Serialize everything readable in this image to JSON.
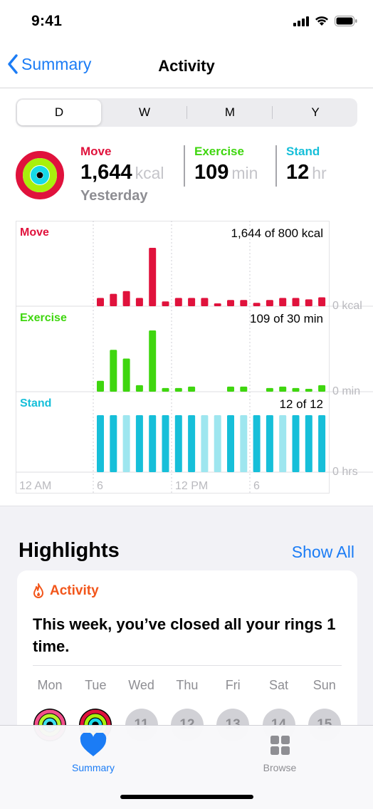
{
  "status_bar": {
    "time": "9:41"
  },
  "nav": {
    "back_label": "Summary",
    "title": "Activity"
  },
  "segments": [
    "D",
    "W",
    "M",
    "Y"
  ],
  "summary": {
    "move": {
      "label": "Move",
      "value": "1,644",
      "unit": "kcal"
    },
    "exercise": {
      "label": "Exercise",
      "value": "109",
      "unit": "min"
    },
    "stand": {
      "label": "Stand",
      "value": "12",
      "unit": "hr"
    },
    "day": "Yesterday"
  },
  "colors": {
    "move": "#e0123c",
    "exercise": "#3fd60f",
    "stand": "#16bfd9",
    "accent": "#1b7cf5",
    "highlight": "#f2561b"
  },
  "chart_data": {
    "type": "bar",
    "hours": [
      0,
      1,
      2,
      3,
      4,
      5,
      6,
      7,
      8,
      9,
      10,
      11,
      12,
      13,
      14,
      15,
      16,
      17,
      18,
      19,
      20,
      21,
      22,
      23
    ],
    "x_ticks": [
      "12 AM",
      "6",
      "12 PM",
      "6"
    ],
    "panels": [
      {
        "name": "Move",
        "total": "1,644 of 800 kcal",
        "axis_label": "0 kcal",
        "max": 85,
        "values": [
          0,
          0,
          0,
          0,
          0,
          0,
          12,
          18,
          22,
          12,
          85,
          7,
          12,
          12,
          12,
          4,
          9,
          9,
          5,
          9,
          12,
          12,
          10,
          13
        ]
      },
      {
        "name": "Exercise",
        "total": "109 of 30 min",
        "axis_label": "0 min",
        "max": 85,
        "values": [
          0,
          0,
          0,
          0,
          0,
          0,
          15,
          58,
          46,
          9,
          85,
          5,
          5,
          7,
          0,
          0,
          7,
          7,
          0,
          5,
          7,
          5,
          4,
          9
        ]
      },
      {
        "name": "Stand",
        "total": "12 of 12",
        "axis_label": "0 hrs",
        "max": 1,
        "values": [
          0,
          0,
          0,
          0,
          0,
          0,
          1,
          1,
          1,
          1,
          1,
          1,
          1,
          1,
          1,
          1,
          1,
          1,
          1,
          1,
          1,
          1,
          1,
          1
        ],
        "stood": [
          0,
          0,
          0,
          0,
          0,
          0,
          1,
          1,
          0,
          1,
          1,
          1,
          1,
          1,
          0,
          0,
          1,
          0,
          1,
          1,
          0,
          1,
          1,
          1
        ]
      }
    ]
  },
  "highlights": {
    "title": "Highlights",
    "show_all": "Show All",
    "card": {
      "category": "Activity",
      "text": "This week, you’ve closed all your rings 1 time."
    },
    "days": [
      {
        "label": "Mon",
        "type": "ring-partial"
      },
      {
        "label": "Tue",
        "type": "ring-closed"
      },
      {
        "label": "Wed",
        "type": "date",
        "date": "11"
      },
      {
        "label": "Thu",
        "type": "date",
        "date": "12"
      },
      {
        "label": "Fri",
        "type": "date",
        "date": "13"
      },
      {
        "label": "Sat",
        "type": "date",
        "date": "14"
      },
      {
        "label": "Sun",
        "type": "date",
        "date": "15"
      }
    ]
  },
  "tab_bar": {
    "summary": "Summary",
    "browse": "Browse"
  },
  "icons": {
    "status": [
      "cellular-signal-icon",
      "wifi-icon",
      "battery-icon"
    ],
    "nav_back": "chevron-left-icon",
    "activity": "flame-icon",
    "summary_tab": "heart-icon",
    "browse_tab": "grid-icon"
  }
}
